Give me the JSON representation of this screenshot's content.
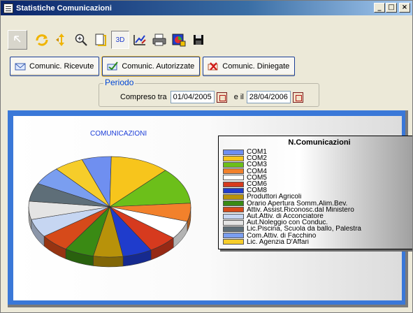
{
  "window": {
    "title": "Statistiche Comunicazioni",
    "controls": [
      "_",
      "□",
      "×"
    ]
  },
  "toolbar": {
    "items": [
      {
        "name": "pointer-icon"
      },
      {
        "name": "rotate-icon"
      },
      {
        "name": "move-icon"
      },
      {
        "name": "zoom-icon"
      },
      {
        "name": "page-icon"
      },
      {
        "name": "3d-toggle",
        "label": "3D"
      },
      {
        "name": "edit-chart-icon"
      },
      {
        "name": "print-icon"
      },
      {
        "name": "copy-image-icon"
      },
      {
        "name": "save-icon"
      }
    ]
  },
  "actions": {
    "ricevute": "Comunic. Ricevute",
    "autorizzate": "Comunic. Autorizzate",
    "diniegate": "Comunic. Diniegate"
  },
  "periodo": {
    "legend": "Periodo",
    "compreso_label": "Compreso tra",
    "date_from": "01/04/2005",
    "e_il_label": "e il",
    "date_to": "28/04/2006"
  },
  "chart_data": {
    "type": "pie",
    "title": "COMUNICAZIONI",
    "legend_title": "N.Comunicazioni",
    "legend_position": "right",
    "three_d": true,
    "series": [
      {
        "name": "COM1",
        "value": 1,
        "color": "#6f8ff0"
      },
      {
        "name": "COM2",
        "value": 2,
        "color": "#f7c51c"
      },
      {
        "name": "COM3",
        "value": 2,
        "color": "#6cbf1a"
      },
      {
        "name": "COM4",
        "value": 1,
        "color": "#f2812b"
      },
      {
        "name": "COM5",
        "value": 1,
        "color": "#ffffff"
      },
      {
        "name": "COM6",
        "value": 1,
        "color": "#d63a1e"
      },
      {
        "name": "COM8",
        "value": 1,
        "color": "#1f3ccc"
      },
      {
        "name": "Produttori Agricoli",
        "value": 1,
        "color": "#b8920a"
      },
      {
        "name": "Orario Apertura Somm.Alim.Bev.",
        "value": 1,
        "color": "#3a8a14"
      },
      {
        "name": "Attiv. Assist.Riconosc.dal Ministero",
        "value": 1,
        "color": "#d64a1a"
      },
      {
        "name": "Aut.Attiv. di Acconciatore",
        "value": 1,
        "color": "#c6d6f2"
      },
      {
        "name": "Aut.Noleggio con Conduc.",
        "value": 1,
        "color": "#e4e4e4"
      },
      {
        "name": "Lic.Piscina, Scuola da ballo, Palestra",
        "value": 1,
        "color": "#5e6e78"
      },
      {
        "name": "Com.Attiv. di Facchino",
        "value": 1,
        "color": "#7a9ef0"
      },
      {
        "name": "Lic. Agenzia D'Affari",
        "value": 1,
        "color": "#f6cd2a"
      }
    ]
  }
}
